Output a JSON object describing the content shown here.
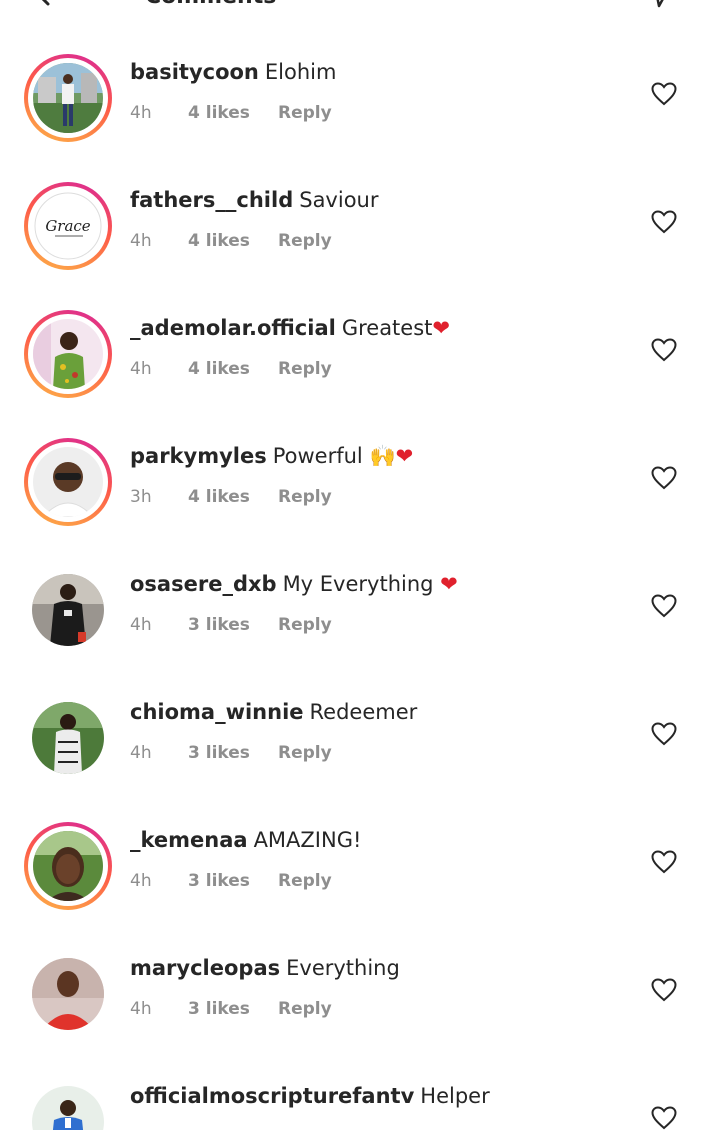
{
  "header": {
    "title": "Comments"
  },
  "comments": [
    {
      "username": "basitycoon",
      "text": "Elohim",
      "emoji": "",
      "time": "4h",
      "likes": "4 likes",
      "reply": "Reply",
      "has_story": true,
      "avatar": "person-photo-green-icon"
    },
    {
      "username": "fathers__child",
      "text": "Saviour",
      "emoji": "",
      "time": "4h",
      "likes": "4 likes",
      "reply": "Reply",
      "has_story": true,
      "avatar": "grace-script-logo",
      "avatar_text": "Grace"
    },
    {
      "username": "_ademolar.official",
      "text": "Greatest",
      "emoji": "❤",
      "time": "4h",
      "likes": "4 likes",
      "reply": "Reply",
      "has_story": true,
      "avatar": "person-photo-pink-icon"
    },
    {
      "username": "parkymyles",
      "text": "Powerful",
      "emoji": "🙌❤",
      "time": "3h",
      "likes": "4 likes",
      "reply": "Reply",
      "has_story": true,
      "avatar": "person-photo-white-icon"
    },
    {
      "username": "osasere_dxb",
      "text": "My Everything",
      "emoji": "❤",
      "time": "4h",
      "likes": "3 likes",
      "reply": "Reply",
      "has_story": false,
      "avatar": "person-photo-dark-icon"
    },
    {
      "username": "chioma_winnie",
      "text": "Redeemer",
      "emoji": "",
      "time": "4h",
      "likes": "3 likes",
      "reply": "Reply",
      "has_story": false,
      "avatar": "person-photo-garden-icon"
    },
    {
      "username": "_kemenaa",
      "text": "AMAZING!",
      "emoji": "",
      "time": "4h",
      "likes": "3 likes",
      "reply": "Reply",
      "has_story": true,
      "avatar": "person-photo-portrait-icon"
    },
    {
      "username": "marycleopas",
      "text": "Everything",
      "emoji": "",
      "time": "4h",
      "likes": "3 likes",
      "reply": "Reply",
      "has_story": false,
      "avatar": "person-photo-red-icon"
    },
    {
      "username": "officialmoscripturefantv",
      "text": "Helper",
      "emoji": "",
      "time": "",
      "likes": "",
      "reply": "",
      "has_story": false,
      "avatar": "person-photo-blue-icon"
    }
  ],
  "colors": {
    "text": "#262626",
    "meta": "#8e8e8e",
    "heart_emoji": "#e0212d",
    "story_ring_start": "#d6249f",
    "story_ring_end": "#fdb347"
  }
}
